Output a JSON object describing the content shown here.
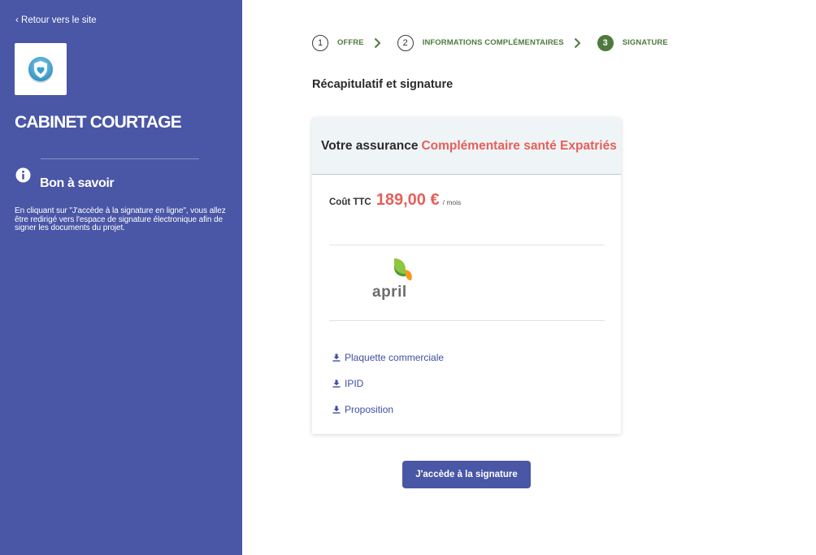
{
  "sidebar": {
    "back_link": "‹ Retour vers le site",
    "cabinet_name": "CABINET COURTAGE",
    "info_title": "Bon à savoir",
    "info_text": "En cliquant sur \"J'accède à la signature en ligne\", vous allez être redirigé vers l'espace de signature électronique afin de signer les documents du projet.",
    "logo_icon": "shield-heart-icon",
    "info_icon": "info-icon"
  },
  "stepper": {
    "steps": [
      {
        "number": "1",
        "label": "OFFRE",
        "state": "done"
      },
      {
        "number": "2",
        "label": "INFORMATIONS COMPLÉMENTAIRES",
        "state": "done"
      },
      {
        "number": "3",
        "label": "SIGNATURE",
        "state": "active"
      }
    ]
  },
  "main": {
    "section_title": "Récapitulatif et signature",
    "card": {
      "header_prefix": "Votre assurance",
      "product_name": "Complémentaire santé Expatriés",
      "price_label": "Coût TTC",
      "price_value": "189,00 €",
      "price_unit": "/ mois",
      "insurer_logo_text": "april",
      "documents": [
        {
          "label": "Plaquette commerciale",
          "icon": "download-icon"
        },
        {
          "label": "IPID",
          "icon": "download-icon"
        },
        {
          "label": "Proposition",
          "icon": "download-icon"
        }
      ]
    },
    "cta_label": "J'accède à la signature"
  },
  "colors": {
    "sidebar_bg": "#4a56a6",
    "accent_red": "#e5605a",
    "step_green": "#4f7a3f",
    "link_blue": "#3f4f9e"
  }
}
